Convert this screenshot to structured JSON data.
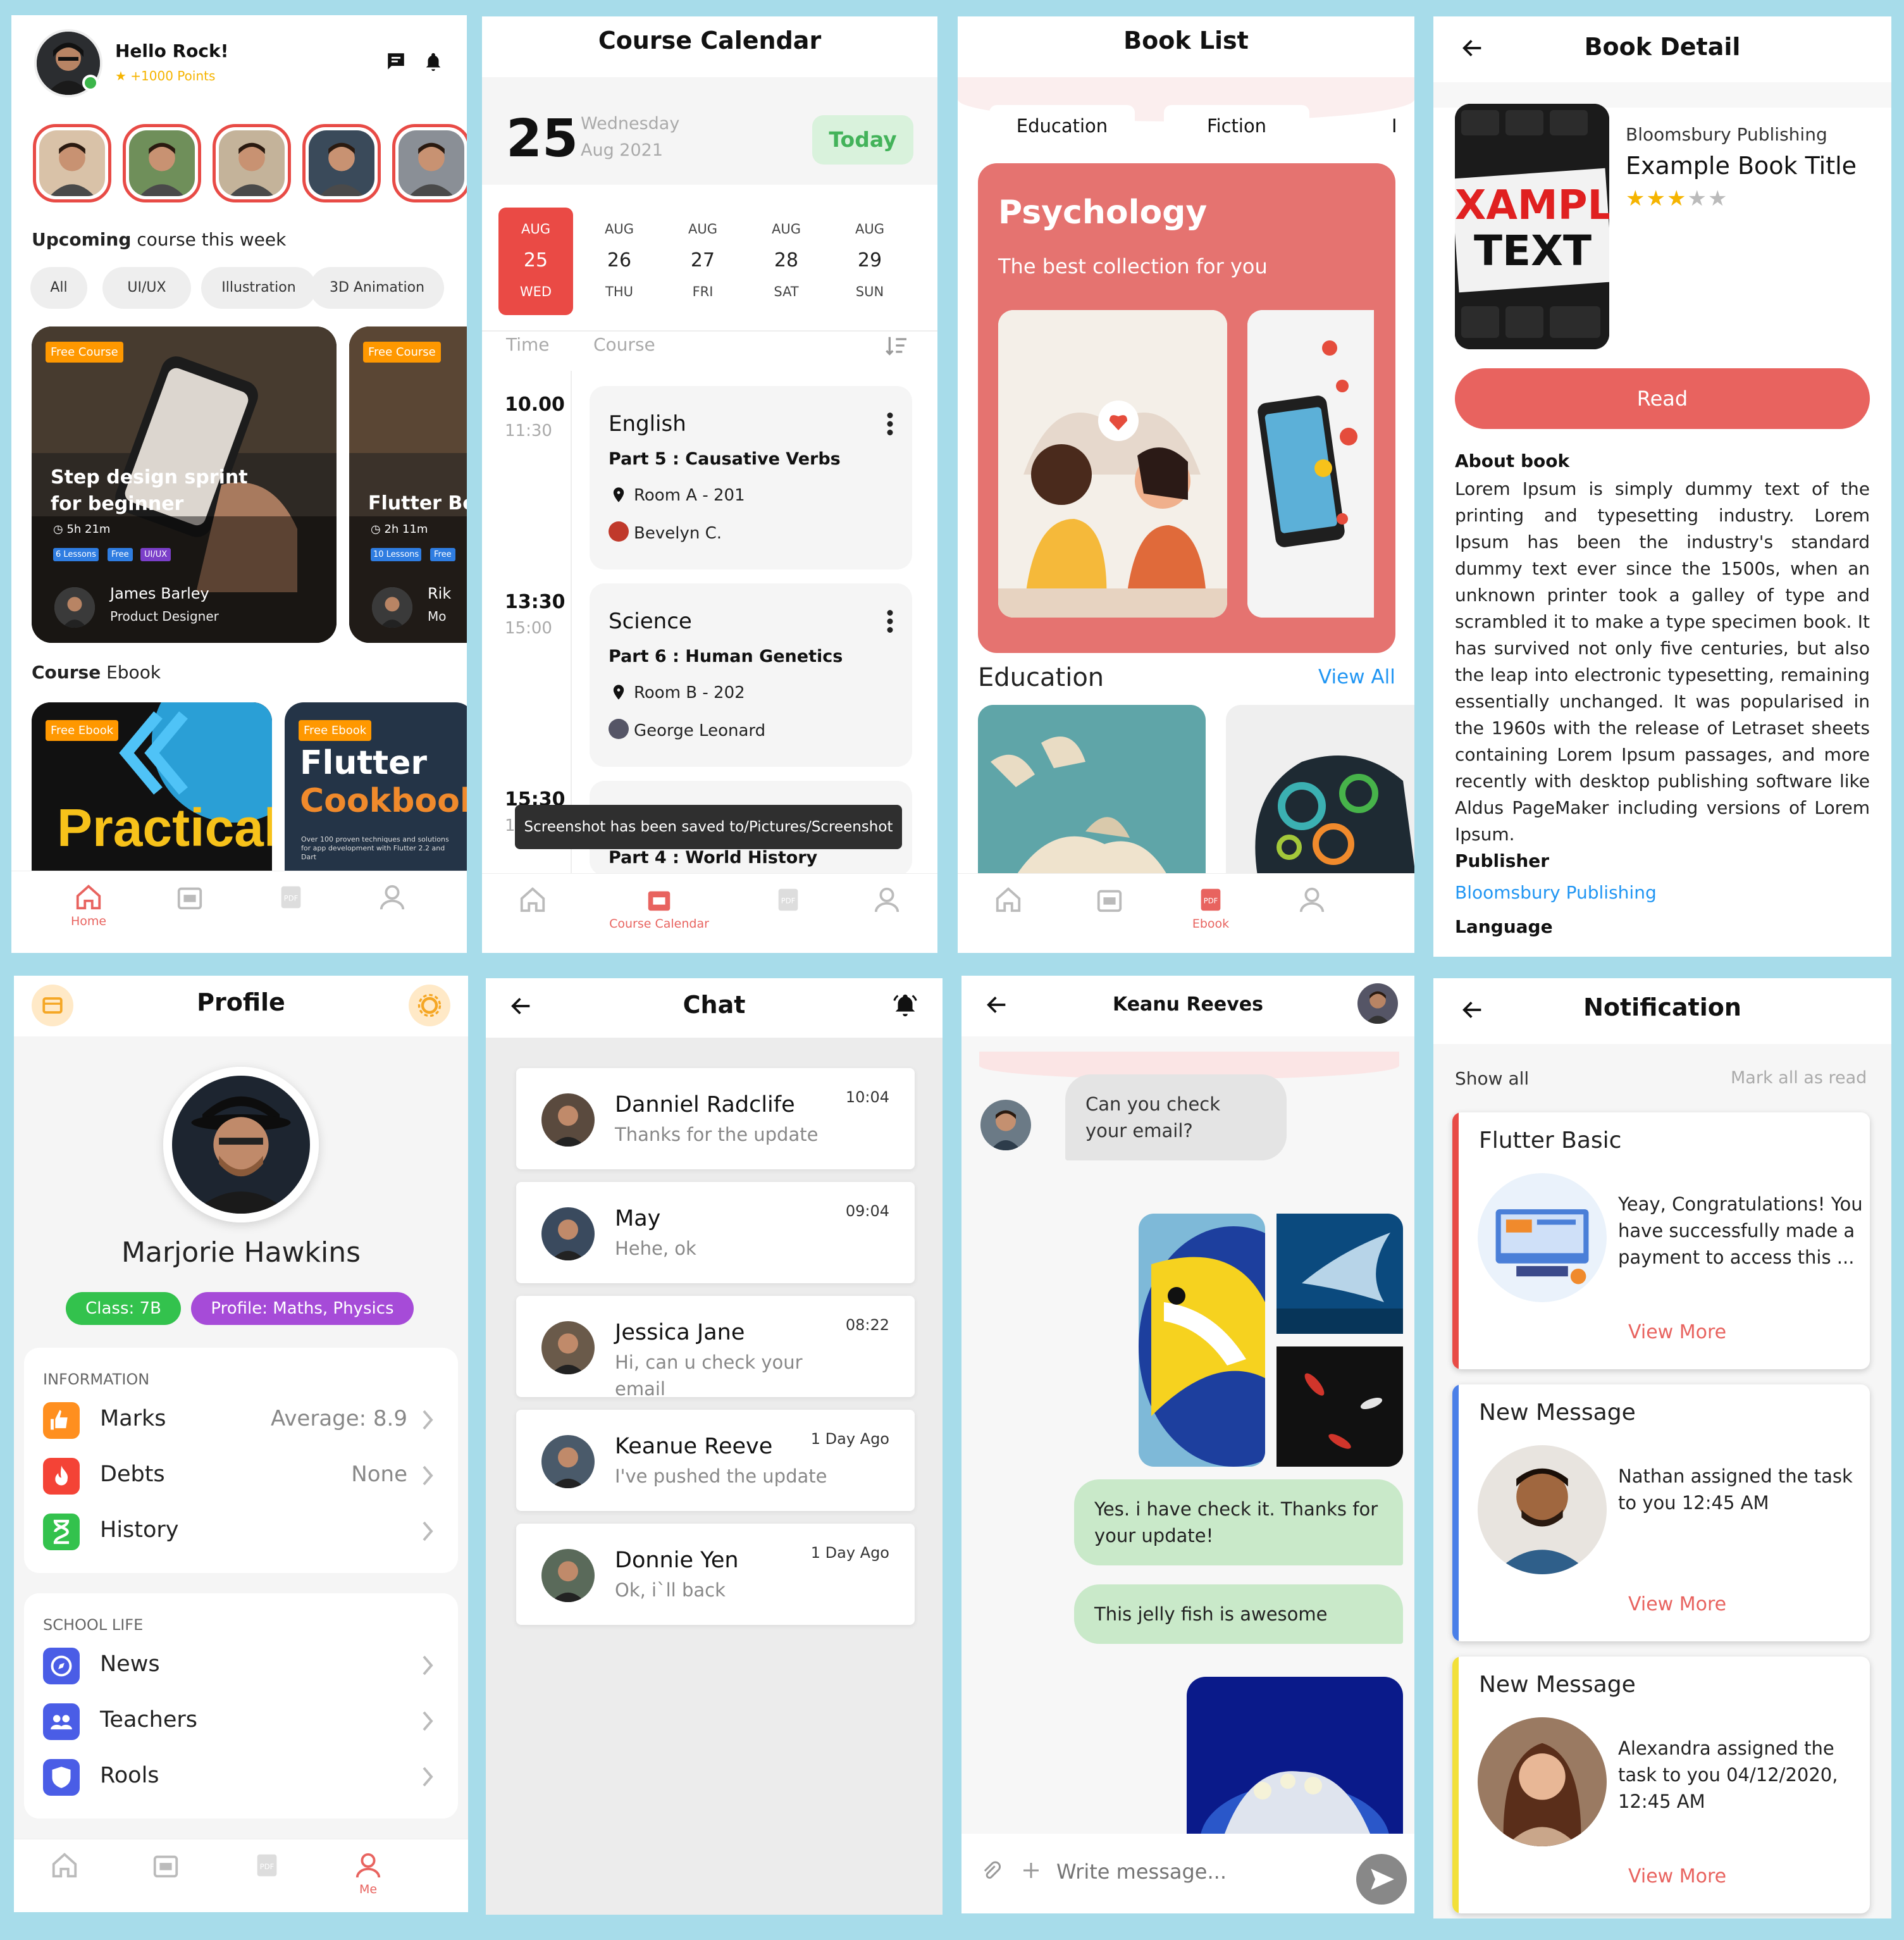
{
  "home": {
    "greeting": "Hello Rock!",
    "points": "+1000 Points",
    "section_upcoming_bold": "Upcoming",
    "section_upcoming_rest": "course this week",
    "chips": [
      "All",
      "UI/UX",
      "Illustration",
      "3D Animation"
    ],
    "card1": {
      "badge": "Free Course",
      "title": "Step design sprint for beginner",
      "duration": "5h 21m",
      "tags": [
        "6 Lessons",
        "Free",
        "UI/UX"
      ],
      "author": "James Barley",
      "role": "Product Designer"
    },
    "card2": {
      "badge": "Free Course",
      "title": "Flutter Bc",
      "duration": "2h 11m",
      "tags": [
        "10 Lessons",
        "Free"
      ],
      "author": "Rik",
      "role": "Mo"
    },
    "section_ebook_bold": "Course",
    "section_ebook_rest": "Ebook",
    "ebook1": {
      "badge": "Free Ebook",
      "title": "Practical"
    },
    "ebook2": {
      "badge": "Free Ebook",
      "title1": "Flutter",
      "title2": "Cookbook",
      "desc": "Over 100 proven techniques and solutions for app development with Flutter 2.2 and Dart"
    },
    "nav": [
      "Home",
      "",
      "",
      ""
    ]
  },
  "calendar": {
    "title": "Course Calendar",
    "day": "25",
    "weekday": "Wednesday",
    "month_year": "Aug 2021",
    "today": "Today",
    "dates": [
      {
        "m": "AUG",
        "d": "25",
        "w": "WED"
      },
      {
        "m": "AUG",
        "d": "26",
        "w": "THU"
      },
      {
        "m": "AUG",
        "d": "27",
        "w": "FRI"
      },
      {
        "m": "AUG",
        "d": "28",
        "w": "SAT"
      },
      {
        "m": "AUG",
        "d": "29",
        "w": "SUN"
      }
    ],
    "col_time": "Time",
    "col_course": "Course",
    "items": [
      {
        "start": "10.00",
        "end": "11:30",
        "subject": "English",
        "part": "Part 5 : Causative Verbs",
        "room": "Room A - 201",
        "teacher": "Bevelyn C."
      },
      {
        "start": "13:30",
        "end": "15:00",
        "subject": "Science",
        "part": "Part 6 : Human Genetics",
        "room": "Room B - 202",
        "teacher": "George Leonard"
      },
      {
        "start": "15:30",
        "end": "1",
        "subject": "",
        "part": "Part 4 : World History",
        "room": "",
        "teacher": ""
      }
    ],
    "toast": "Screenshot has been saved to/Pictures/Screenshot",
    "nav_active": "Course Calendar"
  },
  "booklist": {
    "title": "Book List",
    "tabs": [
      "Education",
      "Fiction",
      "I"
    ],
    "banner_title": "Psychology",
    "banner_sub": "The best collection for you",
    "section": "Education",
    "view_all": "View All",
    "nav_active": "Ebook"
  },
  "bookdetail": {
    "title": "Book Detail",
    "publisher_top": "Bloomsbury Publishing",
    "book_title": "Example Book Title",
    "rating": 3,
    "cover_text1": "XAMPL",
    "cover_text2": "TEXT",
    "read": "Read",
    "about_label": "About book",
    "about": "Lorem Ipsum is simply dummy text of the printing and typesetting industry. Lorem Ipsum has been the industry's standard dummy text ever since the 1500s, when an unknown printer took a galley of type and scrambled it to make a type specimen book. It has survived not only five centuries, but also the leap into electronic typesetting, remaining essentially unchanged. It was popularised in the 1960s with the release of Letraset sheets containing Lorem Ipsum passages, and more recently with desktop publishing software like Aldus PageMaker including versions of Lorem Ipsum.",
    "publisher_label": "Publisher",
    "publisher": "Bloomsbury Publishing",
    "language_label": "Language"
  },
  "profile": {
    "title": "Profile",
    "name": "Marjorie Hawkins",
    "class_badge": "Class: 7B",
    "profile_badge": "Profile: Maths, Physics",
    "info_header": "INFORMATION",
    "info": [
      {
        "label": "Marks",
        "value": "Average: 8.9"
      },
      {
        "label": "Debts",
        "value": "None"
      },
      {
        "label": "History",
        "value": ""
      }
    ],
    "school_header": "SCHOOL LIFE",
    "school": [
      {
        "label": "News"
      },
      {
        "label": "Teachers"
      },
      {
        "label": "Rools"
      }
    ],
    "nav_active": "Me"
  },
  "chat": {
    "title": "Chat",
    "threads": [
      {
        "name": "Danniel Radclife",
        "msg": "Thanks for the update",
        "time": "10:04"
      },
      {
        "name": "May",
        "msg": "Hehe, ok",
        "time": "09:04"
      },
      {
        "name": "Jessica Jane",
        "msg": "Hi, can u check your email",
        "time": "08:22"
      },
      {
        "name": "Keanue Reeve",
        "msg": "I've pushed the update",
        "time": "1 Day Ago"
      },
      {
        "name": "Donnie Yen",
        "msg": "Ok, i`ll back",
        "time": "1 Day Ago"
      }
    ]
  },
  "conversation": {
    "title": "Keanu Reeves",
    "incoming": "Can you check your email?",
    "reply1": "Yes. i have check it. Thanks for your update!",
    "reply2": "This jelly fish is awesome",
    "placeholder": "Write message..."
  },
  "notifications": {
    "title": "Notification",
    "show_all": "Show all",
    "mark_read": "Mark all as read",
    "items": [
      {
        "title": "Flutter Basic",
        "body": "Yeay, Congratulations! You have successfully made a payment to access this ...",
        "more": "View More"
      },
      {
        "title": "New Message",
        "body": "Nathan assigned the task to you 12:45 AM",
        "more": "View More"
      },
      {
        "title": "New Message",
        "body": "Alexandra assigned the task to you 04/12/2020, 12:45 AM",
        "more": "View More"
      }
    ]
  },
  "colors": {
    "accent": "#e8635f",
    "banner": "#e57370",
    "link": "#2196f3",
    "green_bubble": "#c9e9c9",
    "class_badge": "#33c24d",
    "profile_badge": "#a64bd8"
  }
}
